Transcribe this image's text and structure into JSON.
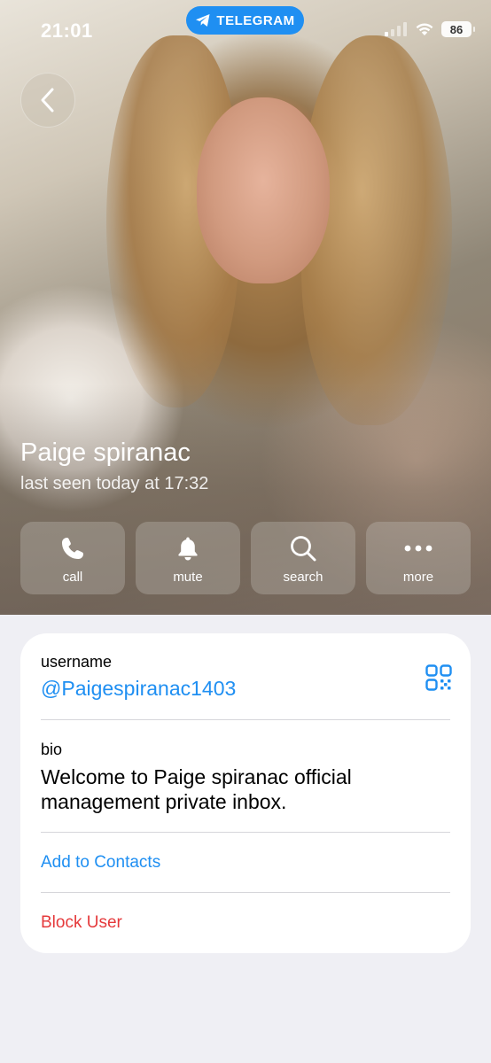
{
  "status_bar": {
    "time": "21:01",
    "app_pill": "TELEGRAM",
    "battery": "86"
  },
  "profile": {
    "name": "Paige spiranac",
    "last_seen": "last seen today at 17:32"
  },
  "actions": [
    {
      "label": "call",
      "icon": "phone-icon"
    },
    {
      "label": "mute",
      "icon": "bell-icon"
    },
    {
      "label": "search",
      "icon": "search-icon"
    },
    {
      "label": "more",
      "icon": "more-icon"
    }
  ],
  "info": {
    "username_label": "username",
    "username_value": "@Paigespiranac1403",
    "bio_label": "bio",
    "bio_text": "Welcome to Paige spiranac official management private inbox.",
    "add_contacts": "Add to Contacts",
    "block_user": "Block User"
  },
  "colors": {
    "accent": "#1f8ff2",
    "danger": "#e5393b",
    "background": "#efeff4"
  }
}
